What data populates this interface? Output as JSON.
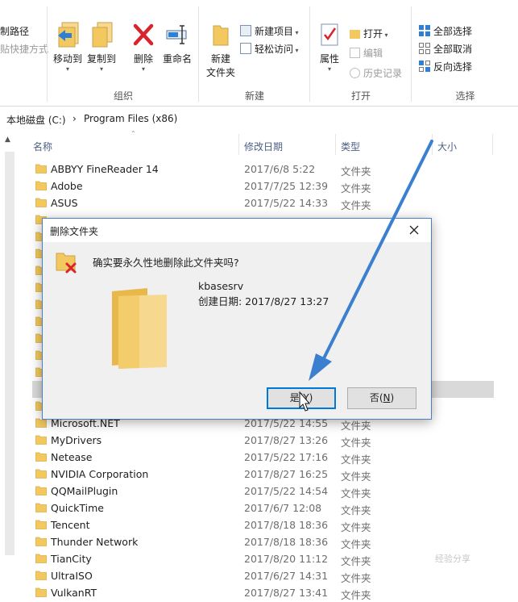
{
  "ribbon": {
    "clipboard_partial": {
      "copy_path": "制路径",
      "paste_shortcut": "贴快捷方式"
    },
    "organize": {
      "label": "组织",
      "move_to": "移动到",
      "copy_to": "复制到",
      "delete": "删除",
      "rename": "重命名"
    },
    "new": {
      "label": "新建",
      "new_folder": "新建\n文件夹",
      "new_item": "新建项目",
      "easy_access": "轻松访问"
    },
    "open": {
      "label": "打开",
      "properties": "属性",
      "open": "打开",
      "edit": "编辑",
      "history": "历史记录"
    },
    "select": {
      "label": "选择",
      "select_all": "全部选择",
      "select_none": "全部取消",
      "invert": "反向选择"
    }
  },
  "address": {
    "part1": "本地磁盘 (C:)",
    "sep": "›",
    "part2": "Program Files (x86)"
  },
  "columns": {
    "name": "名称",
    "date": "修改日期",
    "type": "类型",
    "size": "大小"
  },
  "files_top": [
    {
      "name": "ABBYY FineReader 14",
      "date": "2017/6/8 5:22",
      "type": "文件夹"
    },
    {
      "name": "Adobe",
      "date": "2017/7/25 12:39",
      "type": "文件夹"
    },
    {
      "name": "ASUS",
      "date": "2017/5/22 14:33",
      "type": "文件夹"
    }
  ],
  "files_bottom": [
    {
      "name": "Microsoft.NET",
      "date": "2017/5/22 14:55",
      "type": "文件夹"
    },
    {
      "name": "MyDrivers",
      "date": "2017/8/27 13:26",
      "type": "文件夹"
    },
    {
      "name": "Netease",
      "date": "2017/5/22 17:16",
      "type": "文件夹"
    },
    {
      "name": "NVIDIA Corporation",
      "date": "2017/8/27 16:25",
      "type": "文件夹"
    },
    {
      "name": "QQMailPlugin",
      "date": "2017/5/22 14:54",
      "type": "文件夹"
    },
    {
      "name": "QuickTime",
      "date": "2017/6/7 12:08",
      "type": "文件夹"
    },
    {
      "name": "Tencent",
      "date": "2017/8/18 18:36",
      "type": "文件夹"
    },
    {
      "name": "Thunder Network",
      "date": "2017/8/18 18:36",
      "type": "文件夹"
    },
    {
      "name": "TianCity",
      "date": "2017/8/20 11:12",
      "type": "文件夹"
    },
    {
      "name": "UltraISO",
      "date": "2017/6/27 14:31",
      "type": "文件夹"
    },
    {
      "name": "VulkanRT",
      "date": "2017/8/27 13:41",
      "type": "文件夹"
    }
  ],
  "dialog": {
    "title": "删除文件夹",
    "message": "确实要永久性地删除此文件夹吗?",
    "folder_name": "kbasesrv",
    "created": "创建日期: 2017/8/27 13:27",
    "yes_label": "是",
    "yes_key": "Y",
    "no_label": "否",
    "no_key": "N"
  },
  "watermark": "经验分享",
  "colors": {
    "accent": "#0078d7",
    "folder": "#f5d37a",
    "arrow": "#3a7fd0",
    "delete_red": "#d9232d"
  }
}
